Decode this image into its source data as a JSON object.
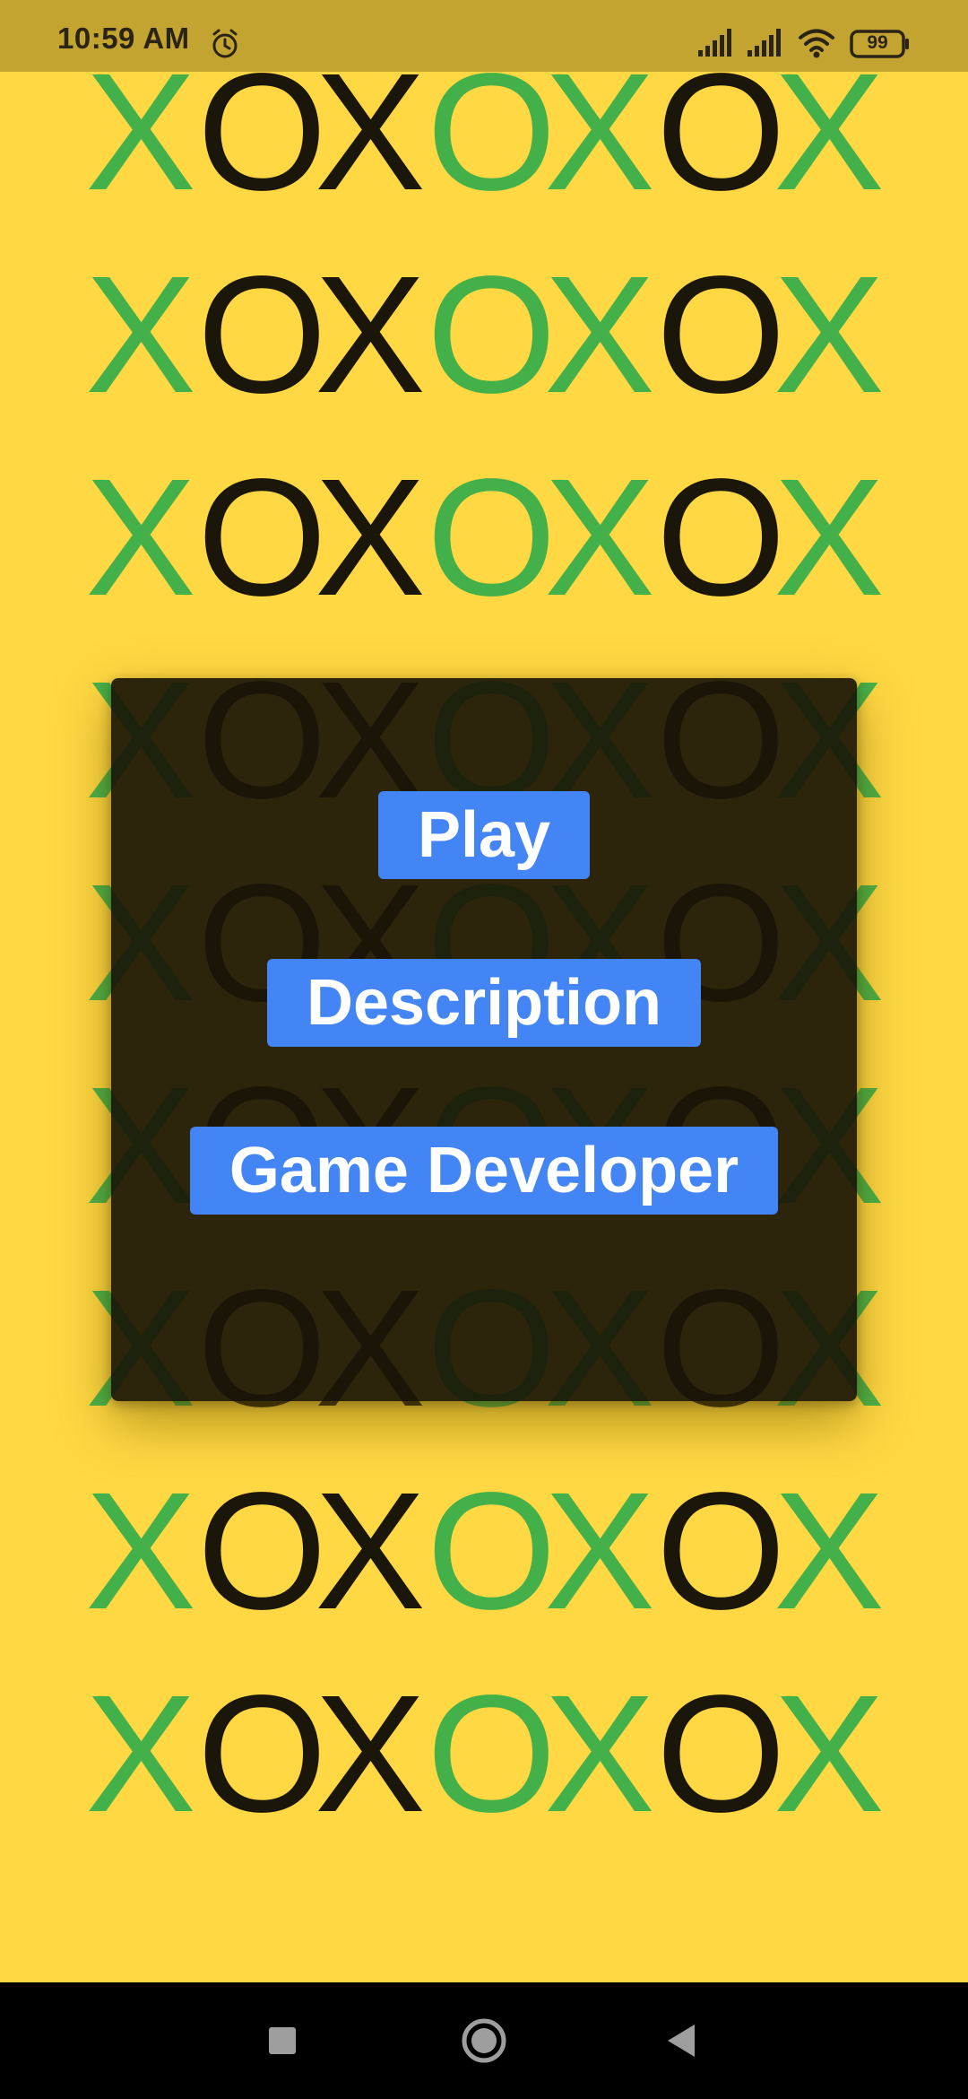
{
  "status_bar": {
    "time": "10:59 AM",
    "battery_level": "99",
    "icons": [
      "alarm-icon",
      "signal-icon",
      "signal-icon",
      "wifi-icon",
      "battery-icon"
    ]
  },
  "background": {
    "pattern_rows": 9,
    "pattern_letters": [
      "X",
      "O",
      "X",
      "O",
      "X",
      "O",
      "X"
    ],
    "letter_colors": [
      "green",
      "black",
      "black",
      "green",
      "green",
      "black",
      "green"
    ]
  },
  "colors": {
    "background": "#FFD843",
    "status_bar": "#C4A431",
    "green": "#44B04A",
    "black": "#1B160A",
    "dialog": "#1A1607",
    "button": "#4385F5",
    "button_text": "#FFFFFF"
  },
  "menu": {
    "play_label": "Play",
    "description_label": "Description",
    "game_developer_label": "Game Developer"
  },
  "nav_bar": {
    "icons": [
      "recents-icon",
      "home-icon",
      "back-icon"
    ]
  }
}
